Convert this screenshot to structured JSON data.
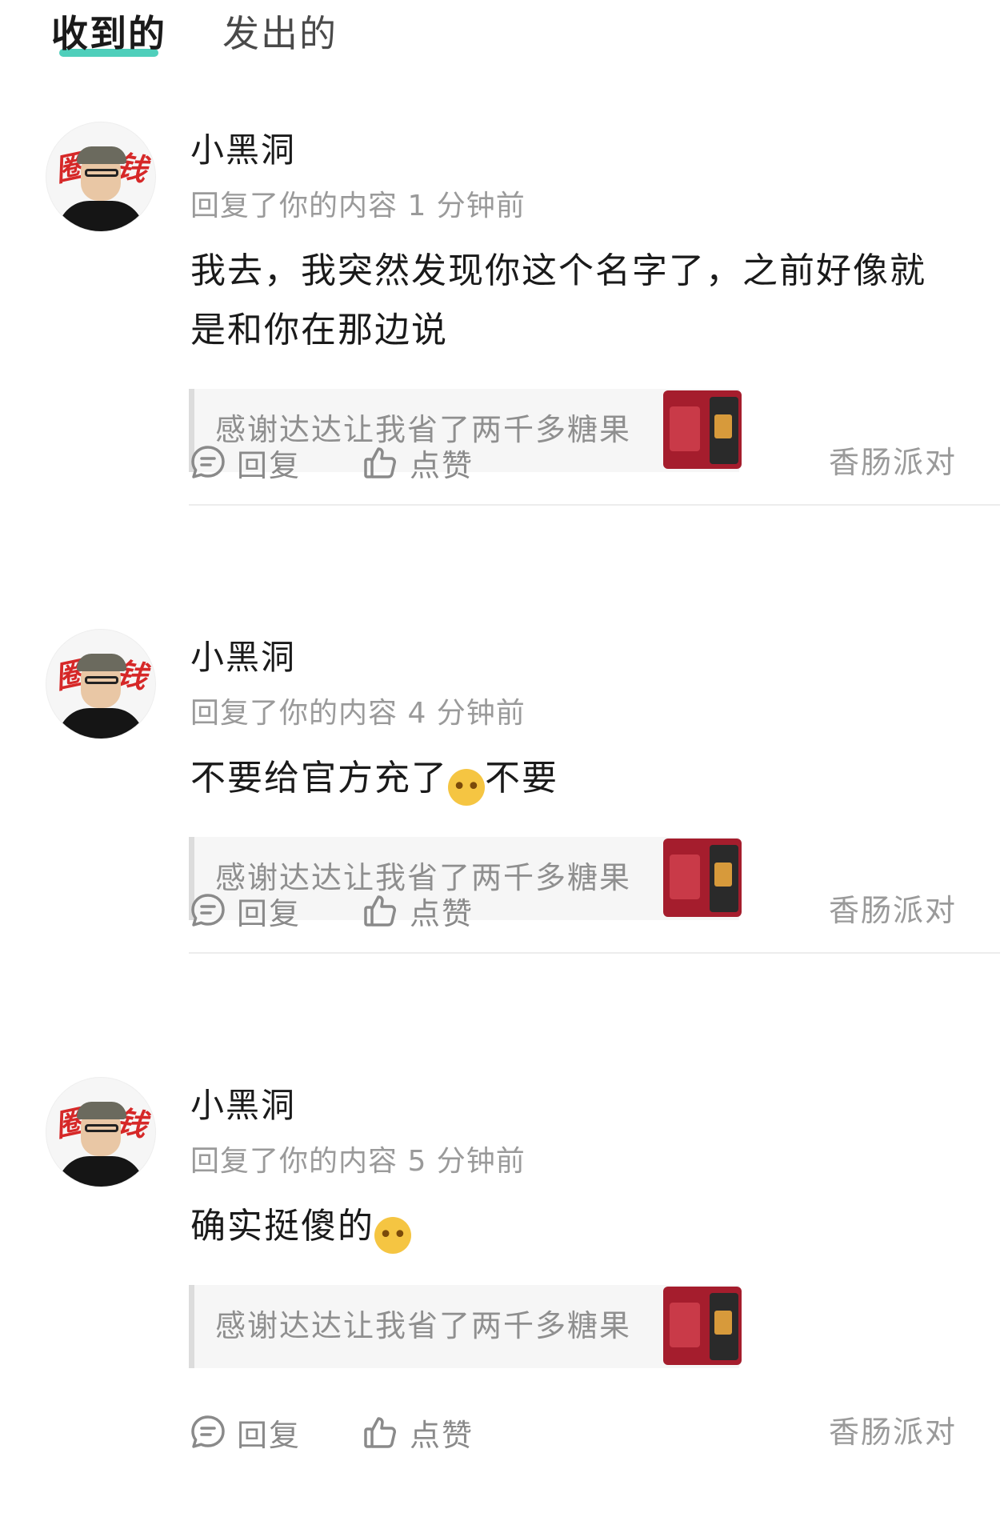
{
  "tabs": {
    "received": "收到的",
    "sent": "发出的"
  },
  "accent_color": "#4fcfbb",
  "avatar_text": [
    "圈",
    "钱"
  ],
  "actions": {
    "reply": "回复",
    "like": "点赞"
  },
  "items": [
    {
      "username": "小黑洞",
      "meta": "回复了你的内容 1 分钟前",
      "content_text": "我去，我突然发现你这个名字了，之前好像就是和你在那边说",
      "content_emoji": "",
      "content_suffix": "",
      "quote": "感谢达达让我省了两千多糖果",
      "category": "香肠派对"
    },
    {
      "username": "小黑洞",
      "meta": "回复了你的内容 4 分钟前",
      "content_text": "不要给官方充了",
      "content_emoji": "crying-emoji",
      "content_suffix": "不要",
      "quote": "感谢达达让我省了两千多糖果",
      "category": "香肠派对"
    },
    {
      "username": "小黑洞",
      "meta": "回复了你的内容 5 分钟前",
      "content_text": "确实挺傻的",
      "content_emoji": "drooling-emoji",
      "content_suffix": "",
      "quote": "感谢达达让我省了两千多糖果",
      "category": "香肠派对"
    }
  ]
}
